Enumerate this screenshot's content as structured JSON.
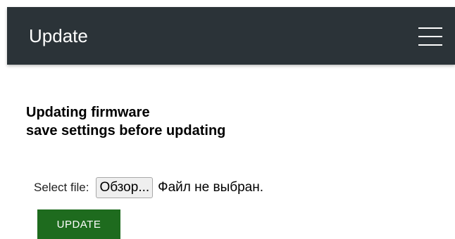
{
  "header": {
    "title": "Update",
    "menu_icon": "hamburger-menu-icon",
    "background_color": "#2b3338"
  },
  "main": {
    "heading_line1": "Updating firmware",
    "heading_line2": "save settings before updating",
    "file_input": {
      "label": "Select file:",
      "browse_label": "Обзор...",
      "status_text": "Файл не выбран."
    },
    "update_button_label": "UPDATE",
    "update_button_color": "#1e6b1e"
  }
}
